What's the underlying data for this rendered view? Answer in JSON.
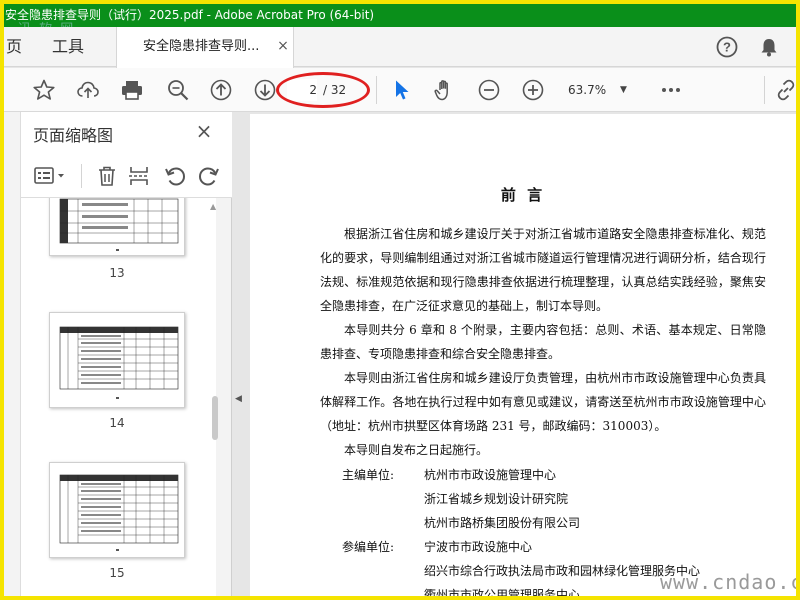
{
  "window": {
    "title": "安全隐患排查导则（试行）2025.pdf - Adobe Acrobat Pro (64-bit)",
    "watermark_top": "迅 软 网"
  },
  "menu": {
    "items": [
      "页",
      "工具"
    ]
  },
  "tab": {
    "label": "安全隐患排查导则...",
    "close": "×"
  },
  "toolbar": {
    "page_current": "2",
    "page_total": "/ 32",
    "zoom": "63.7%",
    "icons": [
      "star-icon",
      "cloud-upload-icon",
      "print-icon",
      "zoom-search-icon",
      "arrow-up-icon",
      "arrow-down-icon",
      "pointer-icon",
      "hand-icon",
      "zoom-out-icon",
      "zoom-in-icon",
      "more-icon",
      "link-icon"
    ]
  },
  "pane": {
    "title": "页面缩略图",
    "close": "×",
    "thumbnails": [
      {
        "label": "13"
      },
      {
        "label": "14"
      },
      {
        "label": "15"
      }
    ]
  },
  "document": {
    "heading": "前 言",
    "paragraphs": [
      "根据浙江省住房和城乡建设厅关于对浙江省城市道路安全隐患排查标准化、规范化的要求，导则编制组通过对浙江省城市隧道运行管理情况进行调研分析，结合现行法规、标准规范依据和现行隐患排查依据进行梳理整理，认真总结实践经验，聚焦安全隐患排查，在广泛征求意见的基础上，制订本导则。",
      "本导则共分 6 章和 8 个附录，主要内容包括：总则、术语、基本规定、日常隐患排查、专项隐患排查和综合安全隐患排查。",
      "本导则由浙江省住房和城乡建设厅负责管理，由杭州市市政设施管理中心负责具体解释工作。各地在执行过程中如有意见或建议，请寄送至杭州市市政设施管理中心（地址：杭州市拱墅区体育场路 231 号，邮政编码：310003）。",
      "本导则自发布之日起施行。"
    ],
    "chief_units_label": "主编单位:",
    "chief_units": [
      "杭州市市政设施管理中心",
      "浙江省城乡规划设计研究院",
      "杭州市路桥集团股份有限公司"
    ],
    "participating_units_label": "参编单位:",
    "participating_units": [
      "宁波市市政设施中心",
      "绍兴市综合行政执法局市政和园林绿化管理服务中心",
      "衢州市市政公用管理服务中心"
    ]
  },
  "watermark_bottom": "www.cndao.com",
  "colors": {
    "titlebar": "#0a8f1a",
    "frame": "#f5e400",
    "annotation": "#e02020",
    "pointer_active": "#1473e6"
  }
}
